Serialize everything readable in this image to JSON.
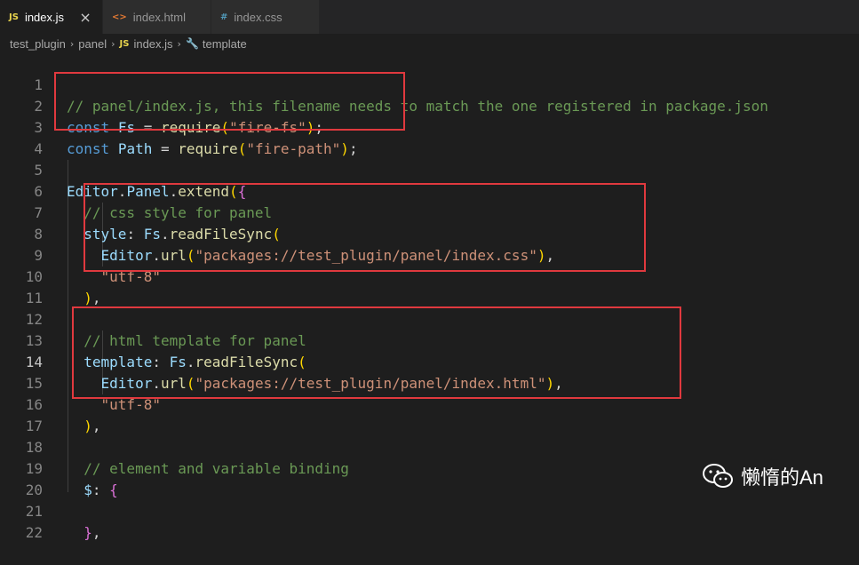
{
  "tabs": [
    {
      "icon": "JS",
      "label": "index.js",
      "close": "×",
      "active": true
    },
    {
      "icon": "<>",
      "label": "index.html",
      "active": false
    },
    {
      "icon": "#",
      "label": "index.css",
      "active": false
    }
  ],
  "breadcrumb": {
    "parts": [
      "test_plugin",
      "panel",
      "index.js",
      "template"
    ],
    "file_icon": "JS",
    "symbol_icon": "wrench-icon"
  },
  "editor": {
    "current_line": 14,
    "lines": [
      {
        "n": "1",
        "text": "// panel/index.js, this filename needs to match the one registered in package.json"
      },
      {
        "n": "2",
        "text": "const Fs = require(\"fire-fs\");"
      },
      {
        "n": "3",
        "text": "const Path = require(\"fire-path\");"
      },
      {
        "n": "4",
        "text": ""
      },
      {
        "n": "5",
        "text": "Editor.Panel.extend({"
      },
      {
        "n": "6",
        "text": "  // css style for panel"
      },
      {
        "n": "7",
        "text": "  style: Fs.readFileSync("
      },
      {
        "n": "8",
        "text": "    Editor.url(\"packages://test_plugin/panel/index.css\"),"
      },
      {
        "n": "9",
        "text": "    \"utf-8\""
      },
      {
        "n": "10",
        "text": "  ),"
      },
      {
        "n": "11",
        "text": ""
      },
      {
        "n": "12",
        "text": "  // html template for panel"
      },
      {
        "n": "13",
        "text": "  template: Fs.readFileSync("
      },
      {
        "n": "14",
        "text": "    Editor.url(\"packages://test_plugin/panel/index.html\"),"
      },
      {
        "n": "15",
        "text": "    \"utf-8\""
      },
      {
        "n": "16",
        "text": "  ),"
      },
      {
        "n": "17",
        "text": ""
      },
      {
        "n": "18",
        "text": "  // element and variable binding"
      },
      {
        "n": "19",
        "text": "  $: {"
      },
      {
        "n": "20",
        "text": ""
      },
      {
        "n": "21",
        "text": "  },"
      },
      {
        "n": "22",
        "text": ""
      }
    ]
  },
  "watermark": {
    "text": "懒惰的An",
    "icon": "wechat-icon"
  },
  "colors": {
    "background": "#1e1e1e",
    "comment": "#6a9955",
    "keyword": "#569cd6",
    "string": "#ce9178",
    "function": "#dcdcaa",
    "variable": "#9cdcfe",
    "highlight_box": "#e0393e",
    "js_icon": "#e8d44d",
    "html_icon": "#e37933",
    "css_icon": "#519aba"
  }
}
